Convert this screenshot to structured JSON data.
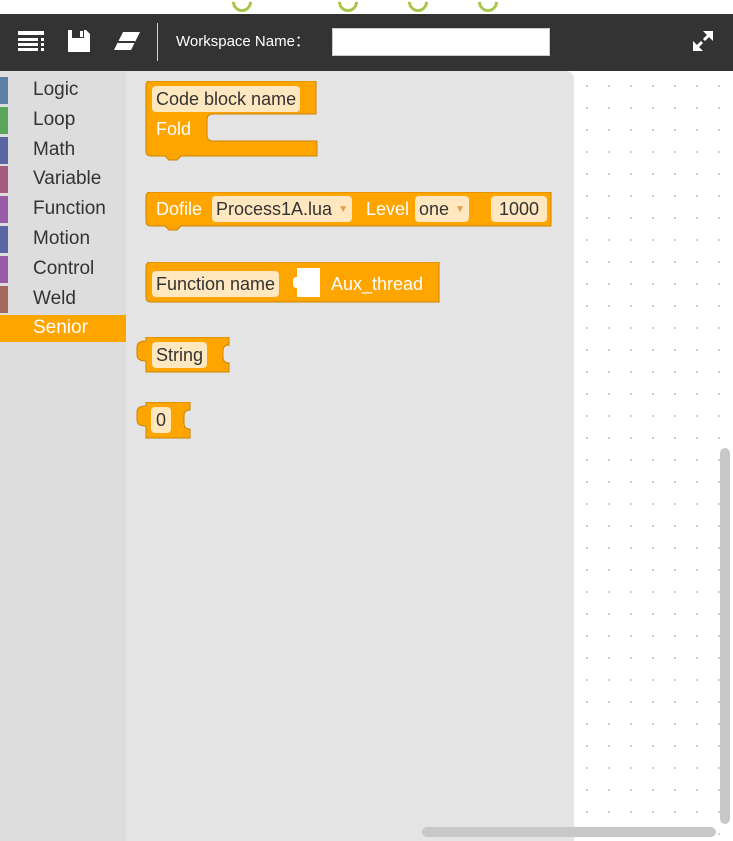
{
  "toolbar": {
    "menu_icon": "list-icon",
    "save_icon": "save-icon",
    "clear_icon": "eraser-icon",
    "fullscreen_icon": "expand-icon",
    "workspace_label": "Workspace Name：",
    "workspace_value": ""
  },
  "categories": [
    {
      "label": "Logic",
      "color": "#5b80a5"
    },
    {
      "label": "Loop",
      "color": "#5ba55b"
    },
    {
      "label": "Math",
      "color": "#5b67a5"
    },
    {
      "label": "Variable",
      "color": "#a55b80"
    },
    {
      "label": "Function",
      "color": "#995ba5"
    },
    {
      "label": "Motion",
      "color": "#5b67a5"
    },
    {
      "label": "Control",
      "color": "#995ba5"
    },
    {
      "label": "Weld",
      "color": "#a5695b"
    },
    {
      "label": "Senior",
      "color": "#ffa500"
    }
  ],
  "blocks": {
    "code_block": {
      "name_field": "Code block name",
      "fold_label": "Fold"
    },
    "dofile": {
      "label": "Dofile",
      "file": "Process1A.lua",
      "level_label": "Level",
      "level": "one",
      "value": "1000"
    },
    "function_name": {
      "label": "Function name",
      "value": "Aux_thread"
    },
    "string": {
      "value": "String"
    },
    "number": {
      "value": "0"
    }
  },
  "colors": {
    "block": "#ffa500",
    "block_border": "#cc8400",
    "field": "#ffe7bf",
    "toolbar": "#333333"
  }
}
